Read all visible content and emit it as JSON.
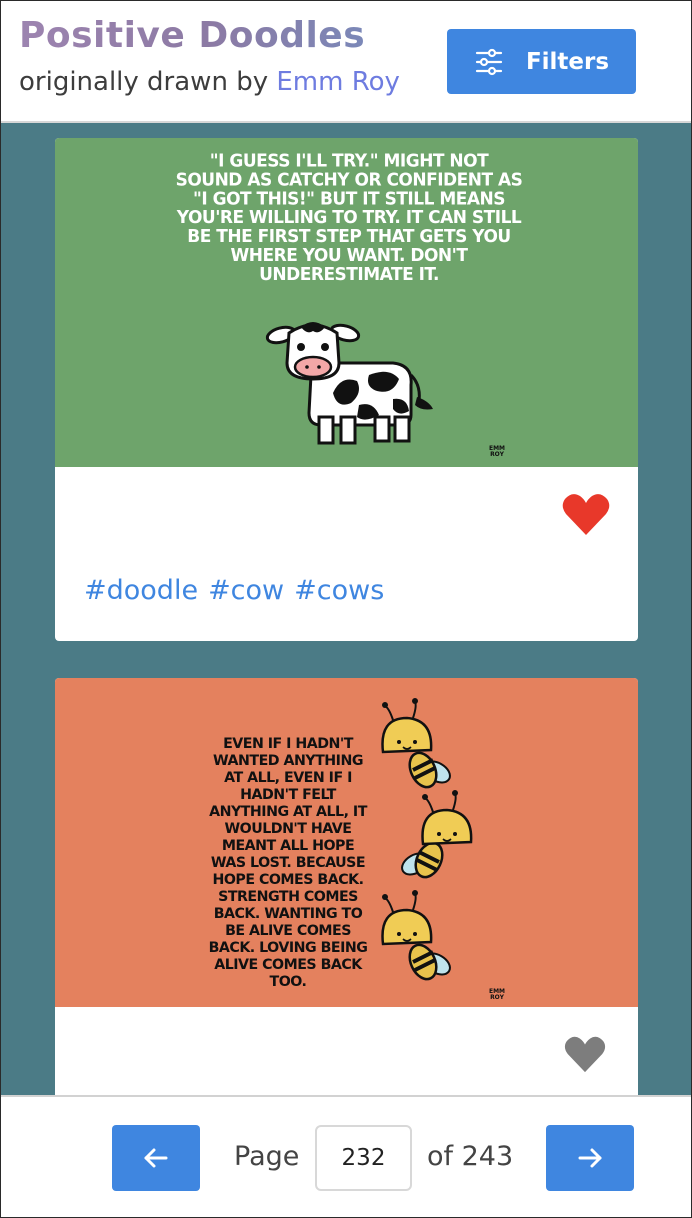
{
  "header": {
    "title": "Positive Doodles",
    "subtitle_prefix": "originally drawn by ",
    "author": "Emm Roy",
    "filters_label": "Filters"
  },
  "cards": [
    {
      "quote": "\"I guess I'll try.\" Might not sound as catchy or confident as \"I got this!\" but it still means you're willing to try. It can still be the first step that gets you where you want. Don't underestimate it.",
      "signature": "EMM ROY",
      "background": "#6ea46b",
      "liked": true,
      "tags": [
        "#doodle",
        "#cow",
        "#cows"
      ]
    },
    {
      "quote": "Even if I hadn't wanted anything at all, even if I hadn't felt anything at all, it wouldn't have meant all hope was lost. Because hope comes back. Strength comes back. Wanting to be alive comes back. Loving being alive comes back too.",
      "signature": "EMM ROY",
      "background": "#e4815e",
      "liked": false
    }
  ],
  "colors": {
    "accent": "#3f86e0",
    "page_background": "#4b7b86",
    "heart_liked": "#e8382a",
    "heart_unliked": "#7d7d7d"
  },
  "pagination": {
    "page_label": "Page",
    "current_page": "232",
    "of_label": "of 243",
    "prev_icon": "arrow-left-icon",
    "next_icon": "arrow-right-icon"
  }
}
